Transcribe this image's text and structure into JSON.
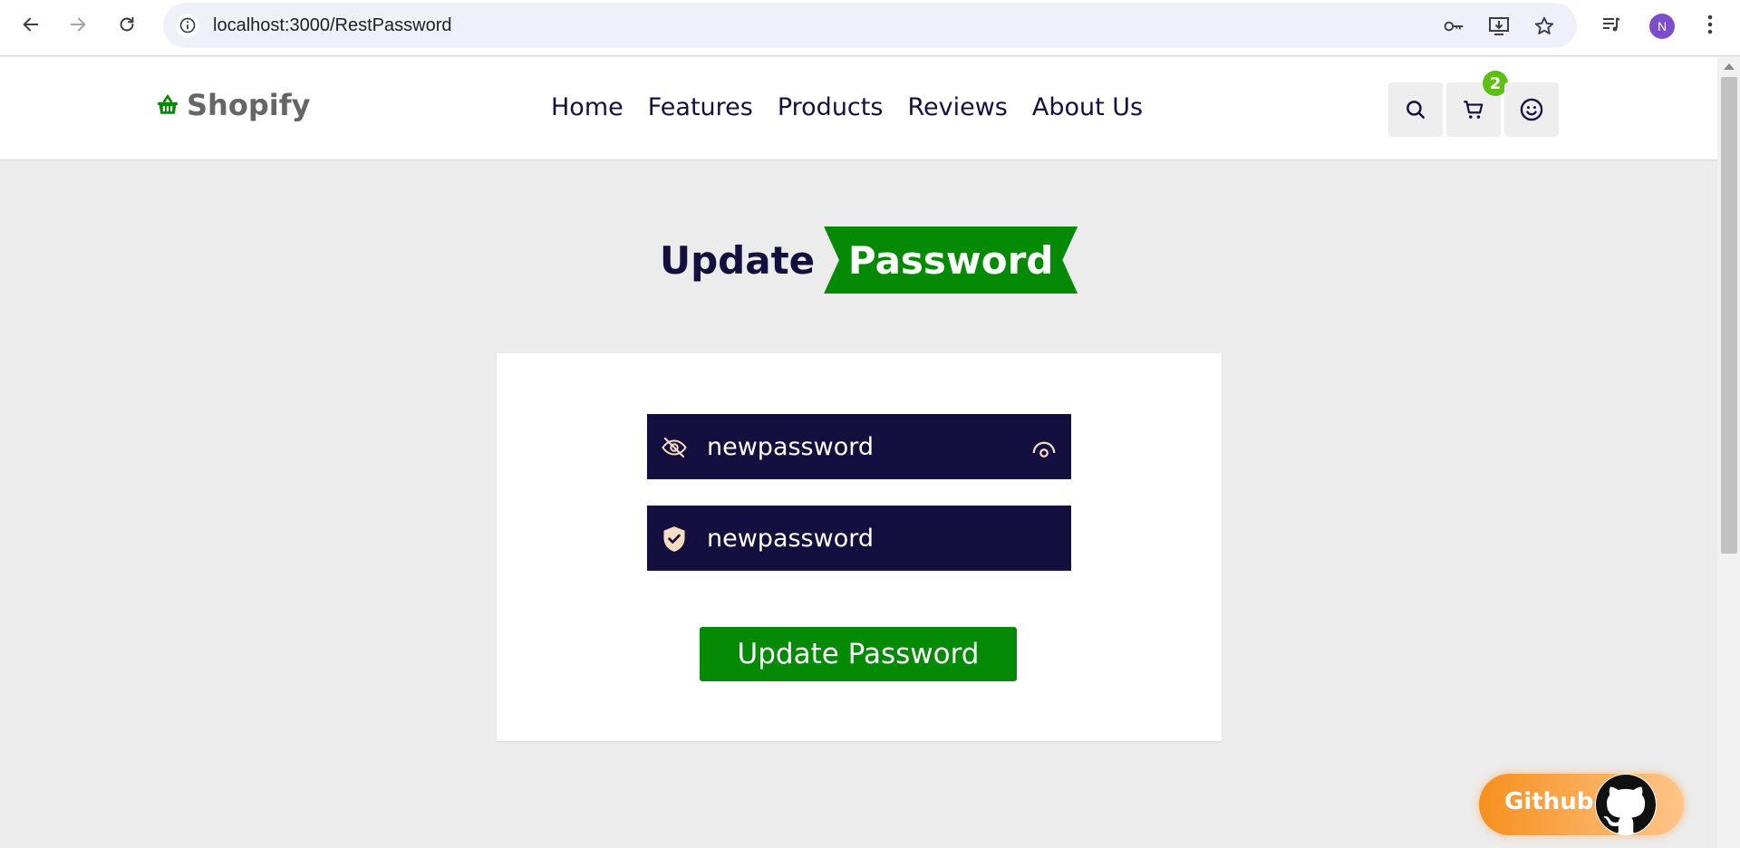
{
  "browser": {
    "url": "localhost:3000/RestPassword",
    "profile_initial": "N"
  },
  "site": {
    "brand": "Shopify",
    "nav": [
      {
        "label": "Home"
      },
      {
        "label": "Features"
      },
      {
        "label": "Products"
      },
      {
        "label": "Reviews"
      },
      {
        "label": "About Us"
      }
    ],
    "cart_count": "2"
  },
  "page": {
    "heading_part1": "Update",
    "heading_part2": "Password"
  },
  "form": {
    "new_password_value": "newpassword",
    "confirm_password_value": "newpassword",
    "submit_label": "Update Password"
  },
  "github_badge": {
    "label": "Github"
  },
  "icons": {
    "brand": "basket-icon",
    "search": "search-icon",
    "cart": "cart-icon",
    "profile": "smiley-icon",
    "field1_left": "eye-slash-icon",
    "field1_right": "eye-icon",
    "field2_left": "shield-check-icon"
  },
  "colors": {
    "brand_green": "#058a05",
    "navy": "#13103f",
    "badge_green": "#5cbf12",
    "github_orange": "#f5901e"
  }
}
